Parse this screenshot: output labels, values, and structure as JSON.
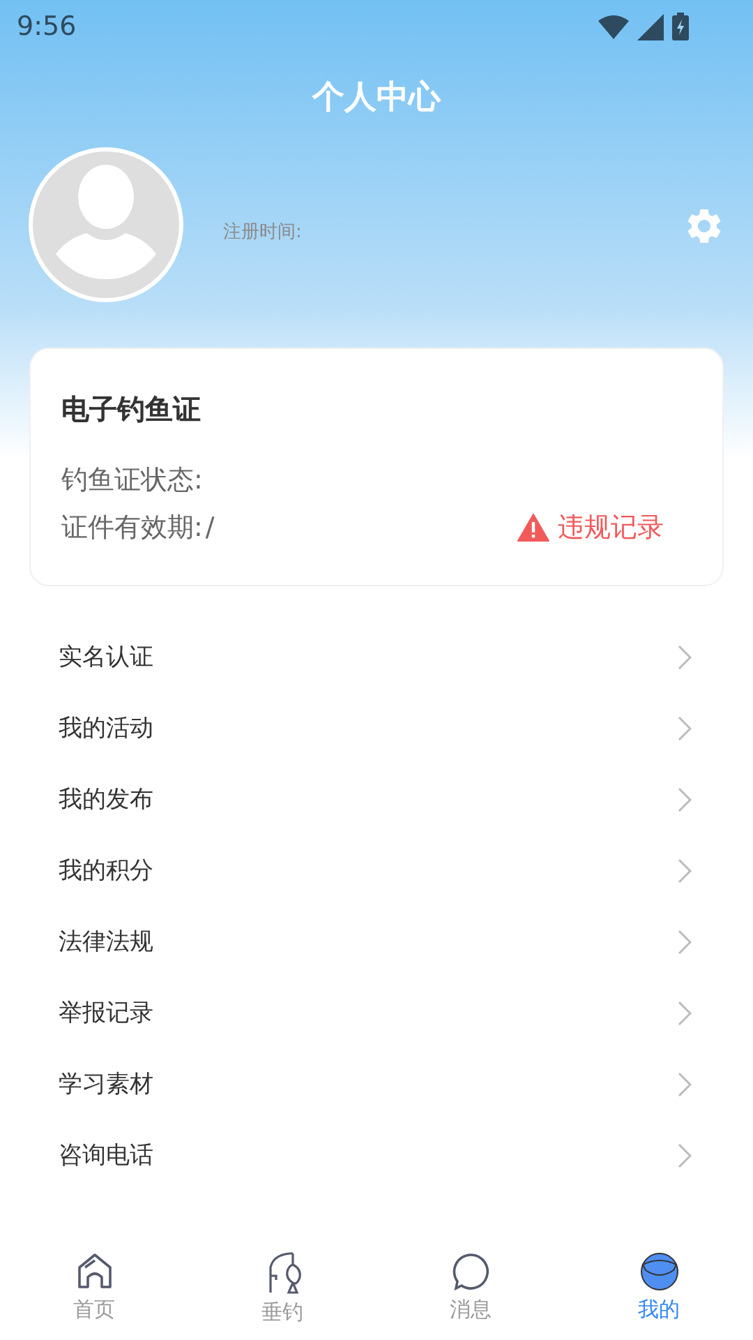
{
  "status_bar": {
    "time": "9:56"
  },
  "header": {
    "title": "个人中心"
  },
  "profile": {
    "registration_label": "注册时间:"
  },
  "license_card": {
    "title": "电子钓鱼证",
    "status_label": "钓鱼证状态:",
    "validity_label": "证件有效期:",
    "validity_value": "/",
    "violations_link": "违规记录"
  },
  "menu": [
    {
      "label": "实名认证"
    },
    {
      "label": "我的活动"
    },
    {
      "label": "我的发布"
    },
    {
      "label": "我的积分"
    },
    {
      "label": "法律法规"
    },
    {
      "label": "举报记录"
    },
    {
      "label": "学习素材"
    },
    {
      "label": "咨询电话"
    }
  ],
  "bottom_nav": [
    {
      "label": "首页",
      "kind": "home",
      "selected": false
    },
    {
      "label": "垂钓",
      "kind": "fishing",
      "selected": false
    },
    {
      "label": "消息",
      "kind": "message",
      "selected": false
    },
    {
      "label": "我的",
      "kind": "profile",
      "selected": true
    }
  ]
}
